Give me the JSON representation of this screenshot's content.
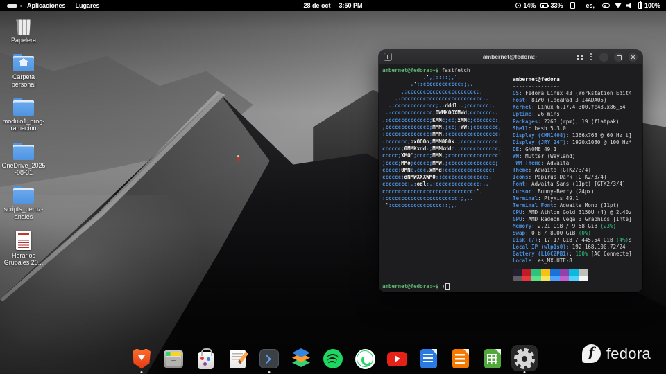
{
  "topbar": {
    "menus": [
      {
        "label": "Aplicaciones"
      },
      {
        "label": "Lugares"
      }
    ],
    "clock": {
      "date": "28 de oct",
      "time": "3:50 PM"
    },
    "status": {
      "peripheral1": "14%",
      "peripheral2": "33%",
      "keyboard": "es,",
      "battery": "100%"
    }
  },
  "desktop": {
    "icons": [
      {
        "id": "trash",
        "type": "di-trash",
        "icon": "trash-icon",
        "label": "Papelera"
      },
      {
        "id": "home-folder",
        "type": "di-folder",
        "icon": "home-folder-icon",
        "label": "Carpeta personal",
        "inner": true
      },
      {
        "id": "folder-modulo1",
        "type": "di-folder",
        "icon": "folder-icon",
        "label": "modulo1_prog-ramacion"
      },
      {
        "id": "folder-onedrive",
        "type": "di-folder",
        "icon": "folder-icon",
        "label": "OneDrive_2025-08-31"
      },
      {
        "id": "folder-scripts",
        "type": "di-folder",
        "icon": "folder-icon",
        "label": "scripts_peroz-anales"
      },
      {
        "id": "doc-horarios",
        "type": "di-doc",
        "icon": "document-icon",
        "label": "Horarios Grupales 20..."
      }
    ]
  },
  "terminal": {
    "title": "ambernet@fedora:~",
    "prompt": "ambernet@fedora:~$",
    "command": "fastfetch",
    "typed": ")",
    "ascii_art": [
      "             .',;::::;,'.",
      "         .';:cccccccccccc:;,.",
      "      .;cccccccccccccccccccccc;.",
      "    .:cccccccccccccccccccccccccc:.",
      "  .;ccccccccccccc;.:dddl:.;ccccccc;.",
      " .:ccccccccccccc;OWMKOOXMWd;ccccccc:.",
      ".:ccccccccccccc;KMMc;cc;xMMc;ccccccc:.",
      ",cccccccccccccc;MMM.;cc;;WW:;cccccccc,",
      ":cccccccccccccc;MMM.;cccccccccccccccc:",
      ":ccccccc;oxOOOo;MMM000k.;cccccccccccc:",
      "cccccc;0MMKxdd:;MMMkddc.;cccccccccccc;",
      "ccccc;XMO';cccc;MMM.;cccccccccccccccc'",
      ")cccc;MMo;ccccc;MMW.;ccccccccccccccc;",
      "ccccc;0MNc.ccc.xMMd;ccccccccccccccc;",
      "cccccc;dNMWXXXWM0:;cccccccccccccc:,",
      "cccccccc;.:odl:.;cccccccccccccc:,.",
      "ccccccccccccccccccccccccccccc:'.",
      ":ccccccccccccccccccccccc:;,..",
      " ':cccccccccccccccc::;,."
    ],
    "info_header": "ambernet@fedora",
    "info_separator": "---------------",
    "info": [
      {
        "label": "OS",
        "text": "Fedora Linux 43 (Workstation Edit4"
      },
      {
        "label": "Host",
        "text": "81W0 (IdeaPad 3 14ADA05)"
      },
      {
        "label": "Kernel",
        "text": "Linux 6.17.4-300.fc43.x86_64"
      },
      {
        "label": "Uptime",
        "text": "26 mins"
      },
      {
        "label": "Packages",
        "text": "2263 (rpm), 19 (flatpak)"
      },
      {
        "label": "Shell",
        "text": "bash 5.3.0"
      },
      {
        "label": "Display (CMN1408)",
        "text": "1366x768 @ 60 Hz i]"
      },
      {
        "label": "Display (JRY 24\")",
        "text": "1920x1080 @ 100 Hz*"
      },
      {
        "label": "DE",
        "text": "GNOME 49.1"
      },
      {
        "label": "WM",
        "text": "Mutter (Wayland)"
      },
      {
        "label": " WM Theme",
        "text": "Adwaita"
      },
      {
        "label": "Theme",
        "text": "Adwaita [GTK2/3/4]"
      },
      {
        "label": "Icons",
        "text": "Papirus-Dark [GTK2/3/4]"
      },
      {
        "label": "Font",
        "text": "Adwaita Sans (11pt) [GTK2/3/4]"
      },
      {
        "label": "Cursor",
        "text": "Bunny-Berry (24px)"
      },
      {
        "label": "Terminal",
        "text": "Ptyxis 49.1"
      },
      {
        "label": "Terminal Font",
        "text": "Adwaita Mono (11pt)"
      },
      {
        "label": "CPU",
        "text": "AMD Athlon Gold 3150U (4) @ 2.40z"
      },
      {
        "label": "GPU",
        "text": "AMD Radeon Vega 3 Graphics [Inte]"
      },
      {
        "label": "Memory",
        "text": "2.21 GiB / 9.58 GiB ",
        "green": "(23%)"
      },
      {
        "label": "Swap",
        "text": "0 B / 8.00 GiB ",
        "green": "(0%)"
      },
      {
        "label": "Disk (/)",
        "text": "17.17 GiB / 445.54 GiB ",
        "green": "(4%)",
        "tail": "s"
      },
      {
        "label": "Local IP (wlp1s0)",
        "text": "192.168.100.72/24"
      },
      {
        "label": "Battery (L16C2PB1)",
        "text": "",
        "green": "100%",
        "tail": " [AC Connecte]"
      },
      {
        "label": "Locale",
        "text": "es_MX.UTF-8"
      }
    ],
    "palette": [
      [
        "#241f31",
        "#c01c28",
        "#2ec27e",
        "#f5c211",
        "#1c71d8",
        "#9141ac",
        "#0ab9dc",
        "#c0bfbc"
      ],
      [
        "#5e5c64",
        "#ed333b",
        "#57e389",
        "#f8e45c",
        "#51a1ff",
        "#c061cb",
        "#4fd2fd",
        "#f6f5f4"
      ]
    ],
    "colors": {
      "label_blue": "#4a8fdd",
      "value_green": "#2ec27e",
      "prompt_green": "#5cb571",
      "art_blue": "#4a8fdd"
    }
  },
  "dock": {
    "items": [
      {
        "id": "brave",
        "icon": "brave-browser-icon",
        "running": true
      },
      {
        "id": "files",
        "icon": "files-app-icon",
        "inner": true
      },
      {
        "id": "software",
        "icon": "software-store-icon"
      },
      {
        "id": "editor",
        "icon": "text-editor-icon"
      },
      {
        "id": "terminal",
        "icon": "terminal-app-icon",
        "running": true
      },
      {
        "id": "layers",
        "icon": "layers-app-icon",
        "inner": true
      },
      {
        "id": "spotify",
        "icon": "spotify-icon",
        "inner": true
      },
      {
        "id": "whatsapp",
        "icon": "whatsapp-icon"
      },
      {
        "id": "youtube",
        "icon": "youtube-icon"
      },
      {
        "id": "lowriter",
        "icon": "libreoffice-writer-icon",
        "doc": true
      },
      {
        "id": "loimpress",
        "icon": "libreoffice-impress-icon",
        "doc": true
      },
      {
        "id": "localc",
        "icon": "libreoffice-calc-icon",
        "doc": true
      },
      {
        "id": "settings",
        "icon": "settings-gear-icon",
        "running": true,
        "focused": true
      }
    ]
  },
  "watermark": {
    "logo": "f",
    "text": "fedora"
  }
}
